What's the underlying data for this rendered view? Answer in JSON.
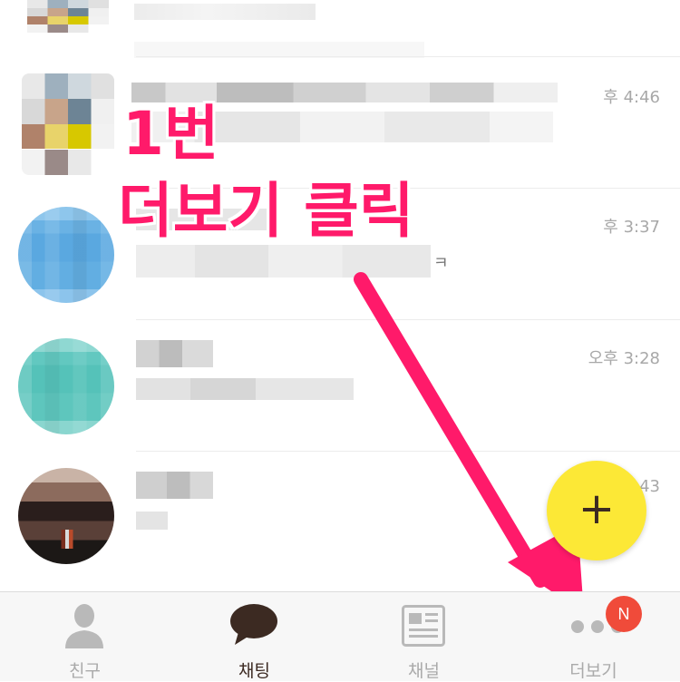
{
  "chat_list": {
    "rows": [
      {
        "time": ""
      },
      {
        "time": "후 4:46"
      },
      {
        "time": "후 3:37",
        "tail": "ㅋ"
      },
      {
        "time": "오후 3:28"
      },
      {
        "time": "43"
      }
    ]
  },
  "annotation": {
    "line1": "1번",
    "line2": "더보기 클릭",
    "color": "#ff1a6a"
  },
  "fab": {
    "symbol": "+",
    "color": "#fce836"
  },
  "tabbar": {
    "tabs": [
      {
        "label": "친구",
        "icon": "person-icon",
        "active": false
      },
      {
        "label": "채팅",
        "icon": "chat-bubble-icon",
        "active": true
      },
      {
        "label": "채널",
        "icon": "newspaper-icon",
        "active": false
      },
      {
        "label": "더보기",
        "icon": "more-dots-icon",
        "active": false
      }
    ],
    "badge": "N"
  }
}
